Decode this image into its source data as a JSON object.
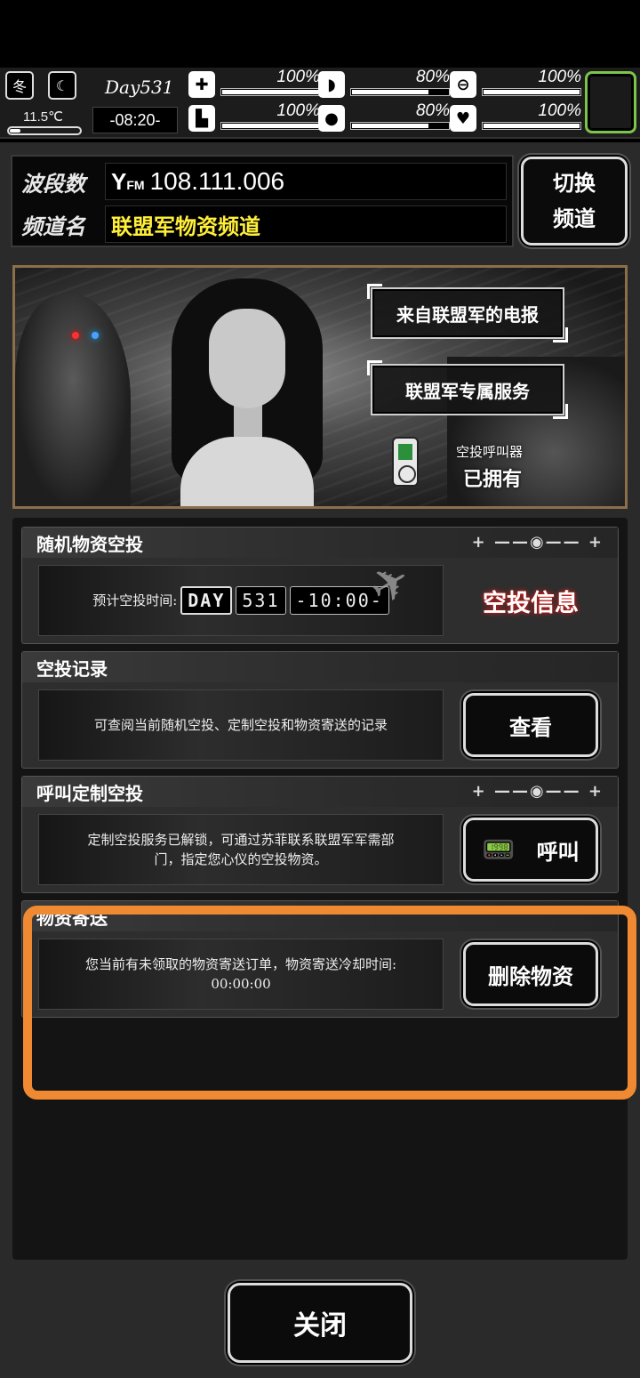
{
  "status": {
    "season": "冬",
    "temperature": "11.5℃",
    "temperature_level": 0.15,
    "day": "Day531",
    "time": "-08:20-",
    "stats": [
      {
        "icon": "medkit-icon",
        "value": "100%",
        "level": 1.0
      },
      {
        "icon": "stomach-icon",
        "value": "80%",
        "level": 0.8
      },
      {
        "icon": "capsule-icon",
        "value": "100%",
        "level": 1.0
      },
      {
        "icon": "boot-icon",
        "value": "100%",
        "level": 1.0
      },
      {
        "icon": "water-drop-icon",
        "value": "80%",
        "level": 0.8
      },
      {
        "icon": "heart-icon",
        "value": "100%",
        "level": 1.0
      }
    ],
    "slot_border_color": "#7dc44a"
  },
  "radio": {
    "band_label": "波段数",
    "channel_label": "频道名",
    "fm_prefix": "FM",
    "frequency": "108.111.006",
    "channel_name": "联盟军物资频道",
    "switch_line1": "切换",
    "switch_line2": "频道"
  },
  "banner": {
    "telegram_button": "来自联盟军的电报",
    "service_button": "联盟军专属服务",
    "caller_label": "空投呼叫器",
    "caller_status": "已拥有"
  },
  "sections": {
    "random_drop": {
      "title": "随机物资空投",
      "eta_label": "预计空投时间:",
      "day_tag": "DAY",
      "day_value": "531",
      "time_value": "-10:00-",
      "info_label": "空投信息"
    },
    "records": {
      "title": "空投记录",
      "description": "可查阅当前随机空投、定制空投和物资寄送的记录",
      "button": "查看"
    },
    "custom_drop": {
      "title": "呼叫定制空投",
      "description": "定制空投服务已解锁，可通过苏菲联系联盟军军需部门，指定您心仪的空投物资。",
      "button": "呼叫"
    },
    "delivery": {
      "title": "物资寄送",
      "description": "您当前有未领取的物资寄送订单，物资寄送冷却时间: 00:00:00",
      "button": "删除物资"
    }
  },
  "footer": {
    "close": "关闭"
  },
  "colors": {
    "channel_text": "#ffef3a",
    "highlight": "#f08a32",
    "banner_border": "#8a6f4a"
  }
}
